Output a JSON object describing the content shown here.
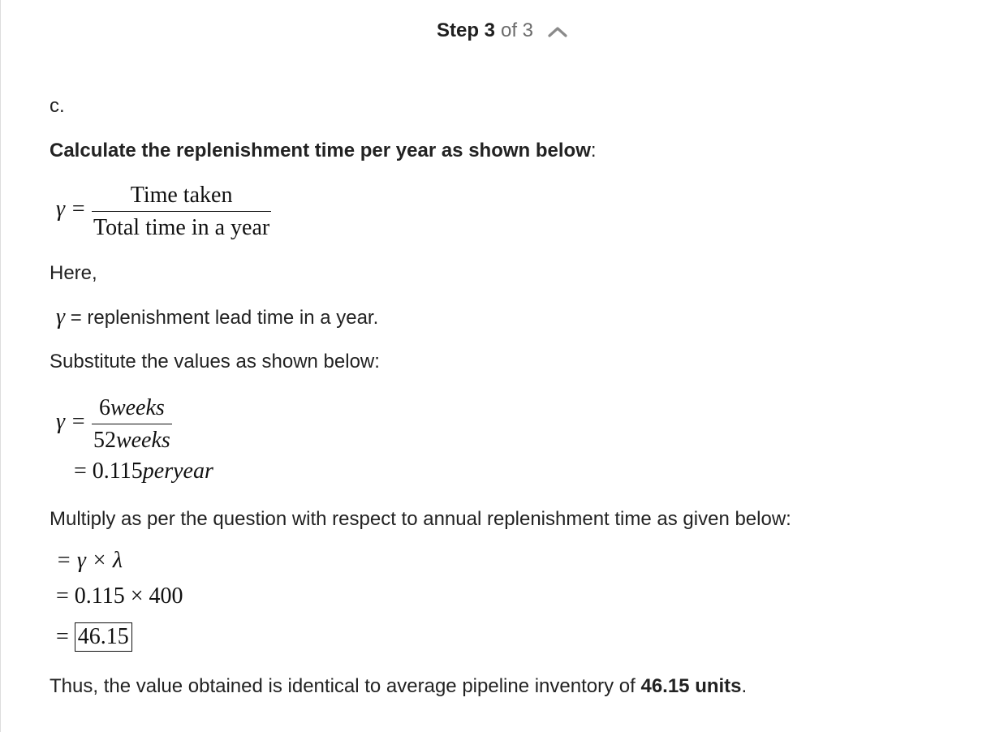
{
  "header": {
    "step_label": "Step 3",
    "of_label": "of 3",
    "collapse_icon": "chevron-up-icon"
  },
  "body": {
    "part_label": "c.",
    "calc_heading": "Calculate the replenishment time per year as shown below",
    "colon": ":",
    "eq1": {
      "lhs": "γ =",
      "numerator": "Time taken",
      "denominator": "Total time in a year"
    },
    "here": "Here,",
    "def_symbol": "γ",
    "definition": "= replenishment lead time in a year.",
    "substitute": "Substitute the values as shown below:",
    "eq2": {
      "lhs": "γ =",
      "num_value": "6",
      "num_unit": "weeks",
      "den_value": "52",
      "den_unit": "weeks",
      "result_prefix": "= 0.115",
      "result_unit": "peryear"
    },
    "multiply": "Multiply as per the question with respect to annual replenishment time as given below:",
    "eq3": {
      "line1": "= γ × λ",
      "line2": "= 0.115 × 400",
      "line3_eq": "=",
      "line3_boxed": "46.15"
    },
    "conclusion_prefix": "Thus, the value obtained is identical to average pipeline inventory of ",
    "conclusion_bold": "46.15 units",
    "conclusion_suffix": "."
  }
}
